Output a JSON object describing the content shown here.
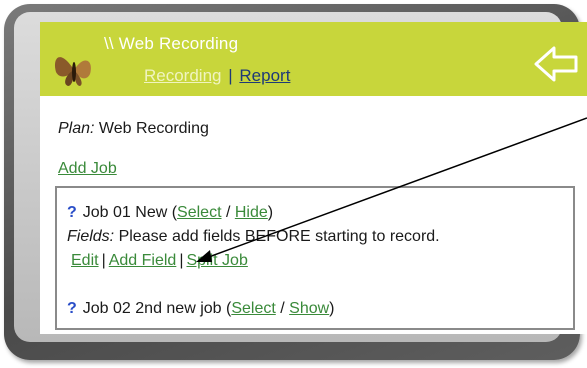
{
  "header": {
    "title": "\\\\ Web Recording",
    "nav": {
      "recording_label": "Recording",
      "separator": "|",
      "report_label": "Report"
    },
    "back_icon": "back-arrow-icon",
    "logo_icon": "butterfly-logo-icon",
    "accent_color": "#c8d63b"
  },
  "plan": {
    "label": "Plan:",
    "value": "Web Recording"
  },
  "add_job_label": "Add Job",
  "jobs": [
    {
      "icon": "?",
      "name": "Job 01 New (",
      "select_label": "Select",
      "slash": " / ",
      "toggle_label": "Hide",
      "close_paren": ")",
      "fields_label": "Fields:",
      "fields_text": " Please add fields BEFORE starting to record.",
      "actions": {
        "edit_label": "Edit",
        "add_field_label": "Add Field",
        "split_job_label": "Split Job",
        "separator": "|"
      }
    },
    {
      "icon": "?",
      "name": "Job 02 2nd new job (",
      "select_label": "Select",
      "slash": " / ",
      "toggle_label": "Show",
      "close_paren": ")"
    }
  ]
}
